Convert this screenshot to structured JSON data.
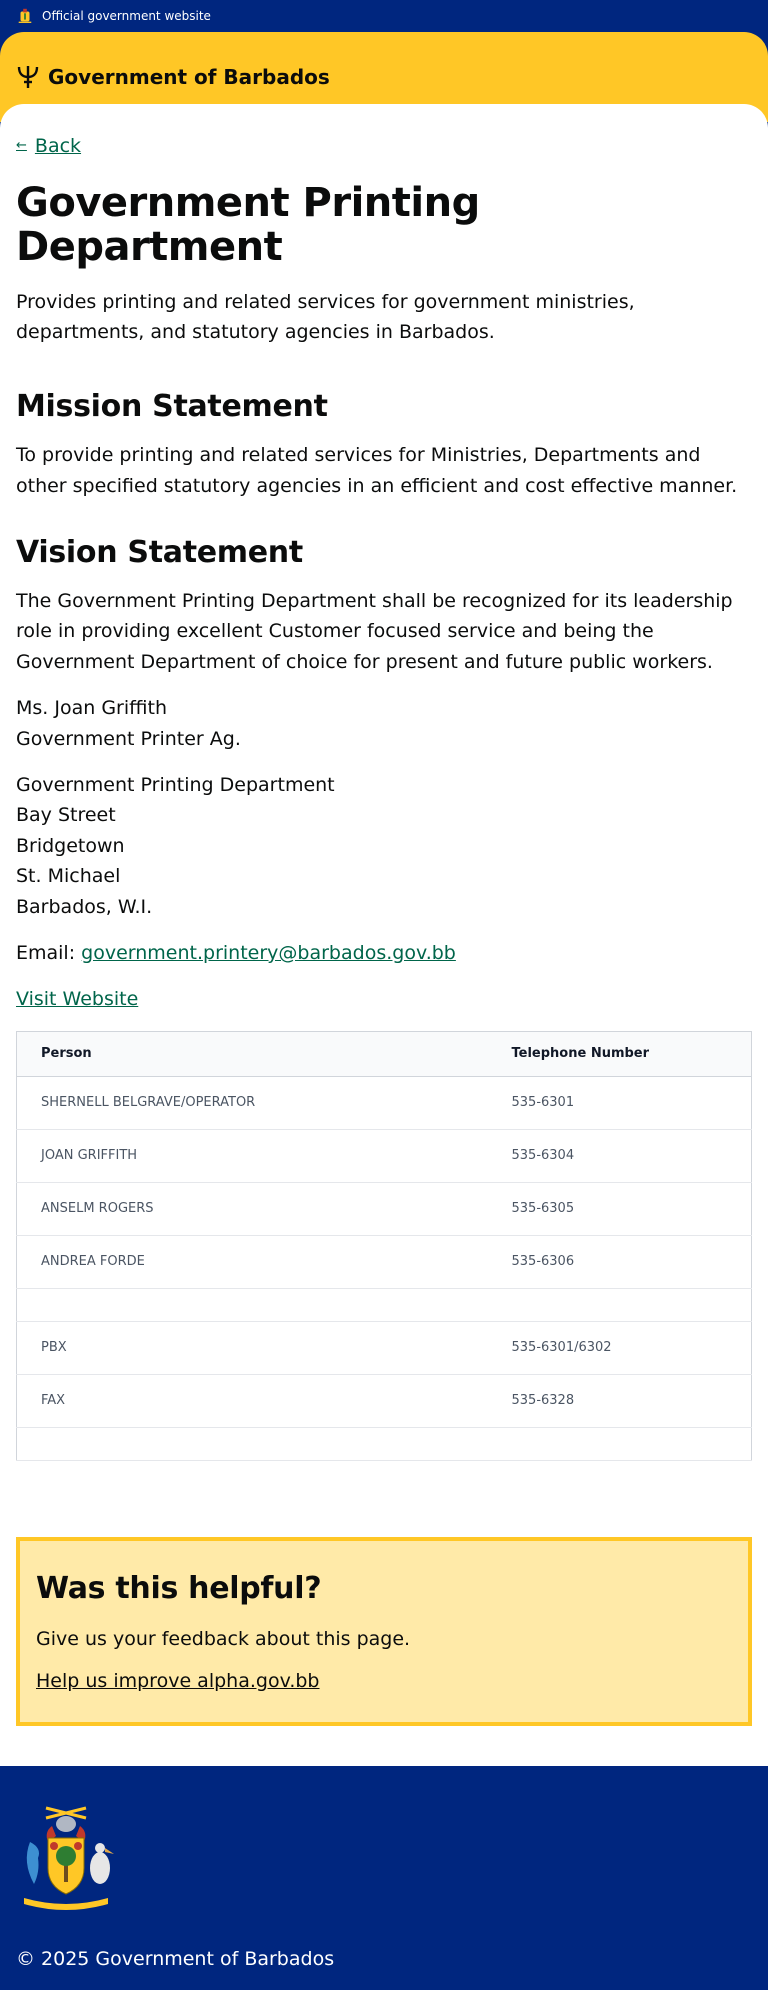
{
  "topbar": {
    "label": "Official government website"
  },
  "header": {
    "site_name": "Government of Barbados"
  },
  "back": {
    "label": "Back"
  },
  "page": {
    "title": "Government Printing Department",
    "lead": "Provides printing and related services for government ministries, departments, and statutory agencies in Barbados."
  },
  "mission": {
    "heading": "Mission Statement",
    "text": "To provide printing and related services for Ministries, Departments and other specified statutory agencies in an efficient and cost effective manner."
  },
  "vision": {
    "heading": "Vision Statement",
    "text": "The Government Printing Department shall be recognized for its leadership role in providing excellent Customer focused service and being the Government Department of choice for present and future public workers."
  },
  "contact_person": {
    "name": "Ms. Joan Griffith",
    "title": "Government Printer Ag."
  },
  "address": {
    "line1": "Government Printing Department",
    "line2": "Bay Street",
    "line3": "Bridgetown",
    "line4": "St. Michael",
    "line5": "Barbados, W.I."
  },
  "email": {
    "label": "Email: ",
    "address": "government.printery@barbados.gov.bb"
  },
  "website": {
    "label": "Visit Website"
  },
  "table": {
    "headers": {
      "person": "Person",
      "phone": "Telephone Number"
    },
    "rows": [
      {
        "person": "SHERNELL BELGRAVE/OPERATOR",
        "phone": "535-6301"
      },
      {
        "person": "JOAN GRIFFITH",
        "phone": "535-6304"
      },
      {
        "person": "ANSELM ROGERS",
        "phone": "535-6305"
      },
      {
        "person": "ANDREA FORDE",
        "phone": "535-6306"
      },
      {
        "person": "",
        "phone": ""
      },
      {
        "person": "PBX",
        "phone": "535-6301/6302"
      },
      {
        "person": "FAX",
        "phone": "535-6328"
      },
      {
        "person": "",
        "phone": ""
      }
    ]
  },
  "feedback": {
    "heading": "Was this helpful?",
    "text": "Give us your feedback about this page.",
    "link": "Help us improve alpha.gov.bb"
  },
  "footer": {
    "copyright": "© 2025 Government of Barbados"
  },
  "colors": {
    "navy": "#00267f",
    "gold": "#ffc726",
    "link_green": "#00654a",
    "feedback_bg": "#ffeaa8"
  },
  "icons": {
    "topbar": "coat-of-arms-icon",
    "header": "trident-icon",
    "back": "arrow-left-icon",
    "footer": "coat-of-arms-icon"
  }
}
